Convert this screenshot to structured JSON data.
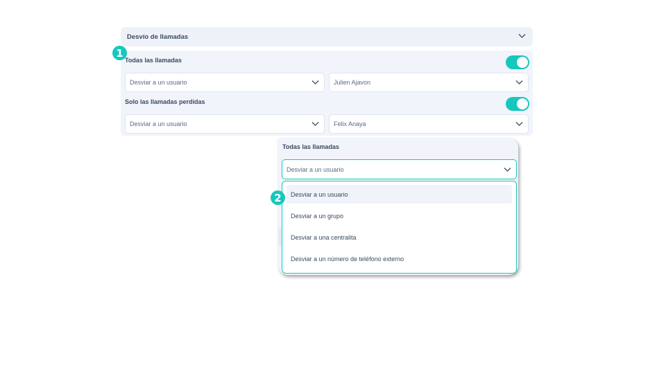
{
  "panel": {
    "title": "Desvío de llamadas",
    "all_calls": {
      "label": "Todas las llamadas",
      "toggle_on": true,
      "action": "Desviar a un usuario",
      "target": "Julien Ajavon"
    },
    "missed_calls": {
      "label": "Solo las llamadas perdidas",
      "toggle_on": true,
      "action": "Desviar a un usuario",
      "target": "Felix Anaya"
    }
  },
  "steps": {
    "one": "1",
    "two": "2"
  },
  "zoom": {
    "title": "Todas las llamadas",
    "selected": "Desviar a un usuario",
    "options": [
      "Desviar a un usuario",
      "Desviar a un grupo",
      "Desviar a una centralita",
      "Desviar a un número de teléfono externo"
    ]
  },
  "colors": {
    "accent": "#16c7bd",
    "panel_bg": "#f1f4fa",
    "text": "#3a4a63"
  }
}
